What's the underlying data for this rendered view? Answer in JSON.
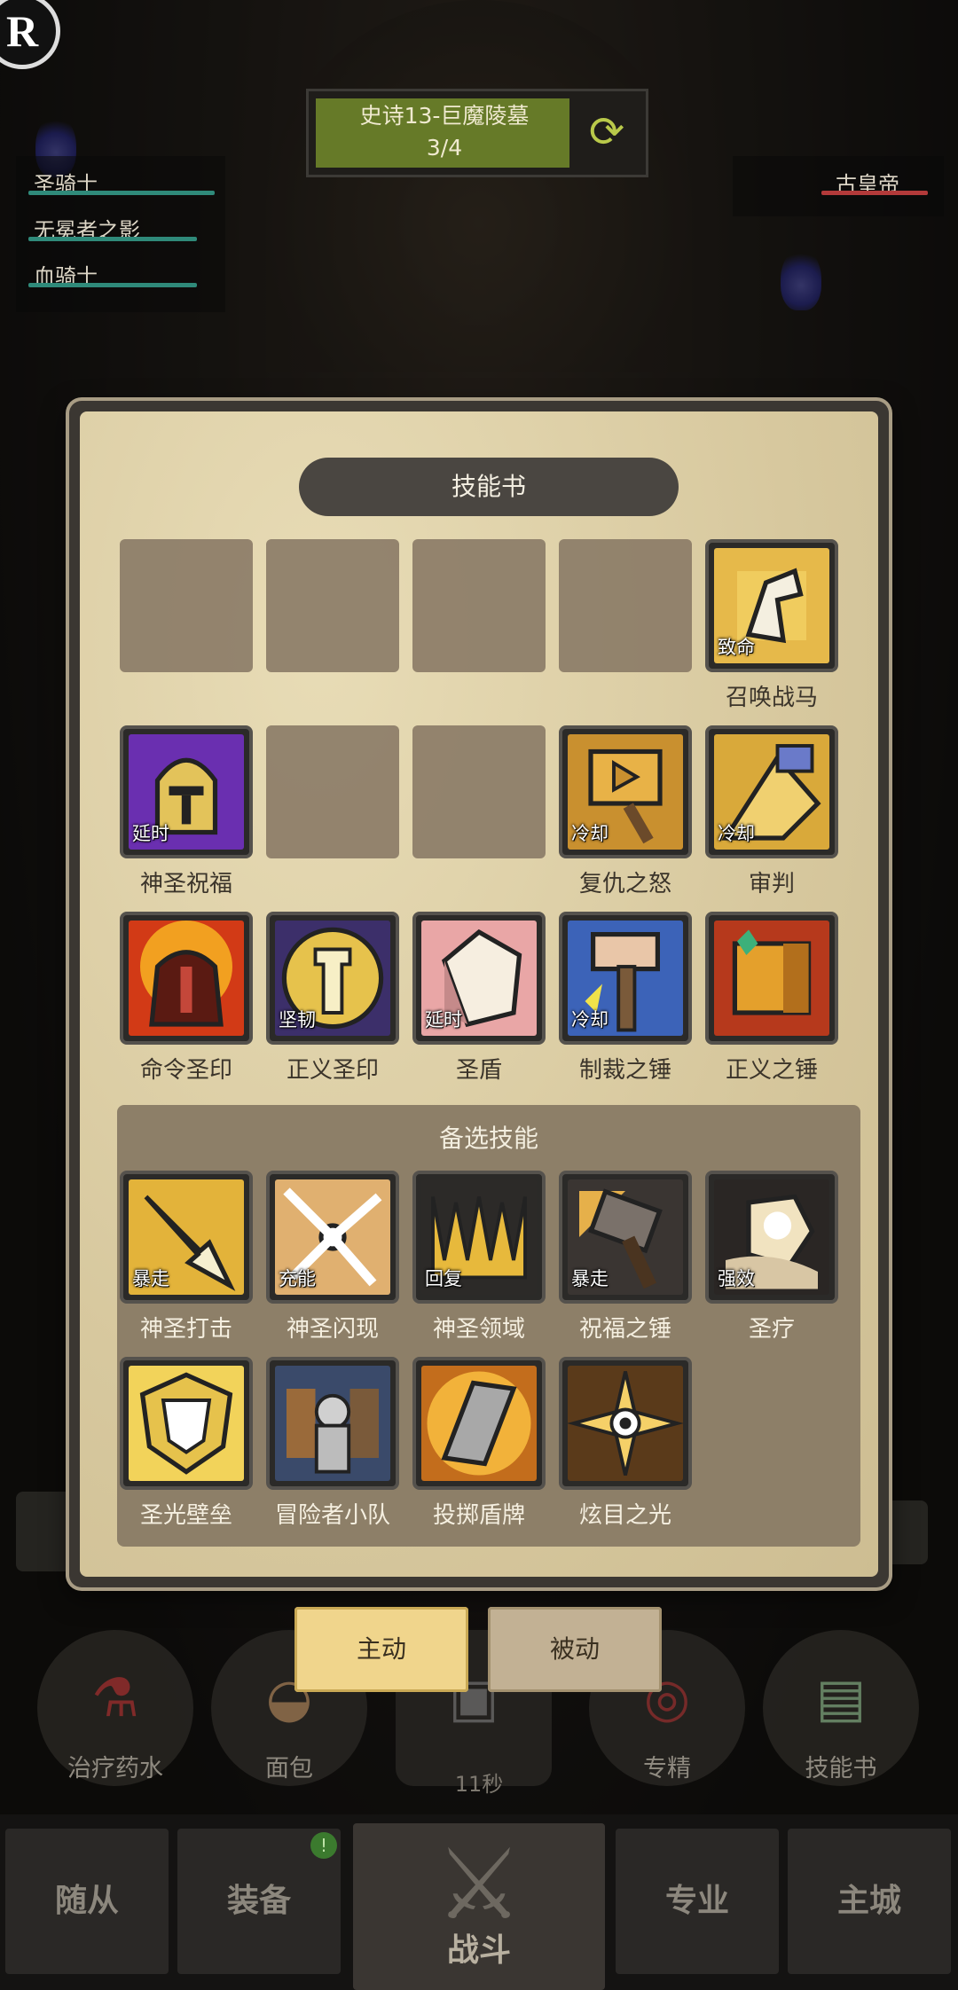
{
  "corner_badge": "R",
  "stage": {
    "title": "史诗13-巨魔陵墓",
    "progress": "3/4",
    "progress_fraction": 0.75
  },
  "party_left": [
    {
      "name": "圣骑士",
      "bar_color": "#2f8a7a"
    },
    {
      "name": "无冕者之影",
      "bar_color": "#2f8a7a"
    },
    {
      "name": "血骑士",
      "bar_color": "#2f8a7a"
    }
  ],
  "party_right": [
    {
      "name": "古皇帝",
      "bar_color": "#b33a3a"
    }
  ],
  "skill_book": {
    "title": "技能书",
    "equipped": [
      {
        "name": "",
        "tag": "",
        "empty": true,
        "art": ""
      },
      {
        "name": "",
        "tag": "",
        "empty": true,
        "art": ""
      },
      {
        "name": "",
        "tag": "",
        "empty": true,
        "art": ""
      },
      {
        "name": "",
        "tag": "",
        "empty": true,
        "art": ""
      },
      {
        "name": "召唤战马",
        "tag": "致命",
        "empty": false,
        "art": "horse"
      },
      {
        "name": "神圣祝福",
        "tag": "延时",
        "empty": false,
        "art": "helmet"
      },
      {
        "name": "",
        "tag": "",
        "empty": true,
        "art": ""
      },
      {
        "name": "",
        "tag": "",
        "empty": true,
        "art": ""
      },
      {
        "name": "复仇之怒",
        "tag": "冷却",
        "empty": false,
        "art": "hammer-gold"
      },
      {
        "name": "审判",
        "tag": "冷却",
        "empty": false,
        "art": "judgment"
      },
      {
        "name": "命令圣印",
        "tag": "",
        "empty": false,
        "art": "red-helm"
      },
      {
        "name": "正义圣印",
        "tag": "坚韧",
        "empty": false,
        "art": "seal"
      },
      {
        "name": "圣盾",
        "tag": "延时",
        "empty": false,
        "art": "shield-pink"
      },
      {
        "name": "制裁之锤",
        "tag": "冷却",
        "empty": false,
        "art": "hammer-blue"
      },
      {
        "name": "正义之锤",
        "tag": "",
        "empty": false,
        "art": "hammer-orange"
      }
    ],
    "candidates_title": "备选技能",
    "candidates": [
      {
        "name": "神圣打击",
        "tag": "暴走",
        "art": "strike"
      },
      {
        "name": "神圣闪现",
        "tag": "充能",
        "art": "flash"
      },
      {
        "name": "神圣领域",
        "tag": "回复",
        "art": "crown"
      },
      {
        "name": "祝福之锤",
        "tag": "暴走",
        "art": "hammer-grey"
      },
      {
        "name": "圣疗",
        "tag": "强效",
        "art": "heal"
      },
      {
        "name": "圣光壁垒",
        "tag": "",
        "art": "bulwark"
      },
      {
        "name": "冒险者小队",
        "tag": "",
        "art": "party"
      },
      {
        "name": "投掷盾牌",
        "tag": "",
        "art": "throw-shield"
      },
      {
        "name": "炫目之光",
        "tag": "",
        "art": "dazzle"
      }
    ]
  },
  "tabs": [
    {
      "label": "主动",
      "active": true
    },
    {
      "label": "被动",
      "active": false
    }
  ],
  "items": [
    {
      "label": "治疗药水",
      "icon": "potion-icon"
    },
    {
      "label": "面包",
      "icon": "bread-icon"
    },
    {
      "label": "",
      "icon": "chest-icon"
    },
    {
      "label": "专精",
      "icon": "target-icon"
    },
    {
      "label": "技能书",
      "icon": "book-icon"
    }
  ],
  "timer": "11秒",
  "nav": {
    "companions": "随从",
    "equipment": "装备",
    "battle": "战斗",
    "profession": "专业",
    "city": "主城",
    "equipment_badge": "!"
  },
  "colors": {
    "accent": "#f0d58c",
    "panel": "#ddcfa8",
    "candidate_bg": "#8d7f68"
  }
}
